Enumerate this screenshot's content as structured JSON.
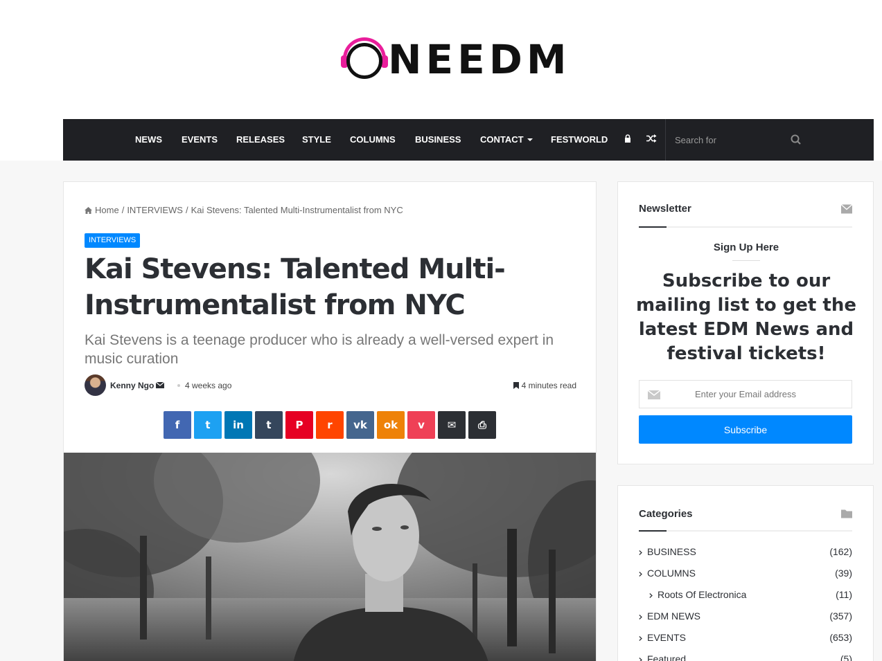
{
  "site": {
    "logo_text": "ONEEDM",
    "logo_rest": "NEEDM"
  },
  "nav": {
    "items": [
      "NEWS",
      "EVENTS",
      "RELEASES",
      "STYLE",
      "COLUMNS",
      "BUSINESS",
      "CONTACT",
      "FESTWORLD"
    ],
    "search_placeholder": "Search for",
    "icons": [
      "lock-icon",
      "random-icon",
      "search-icon"
    ]
  },
  "breadcrumb": {
    "home": "Home",
    "section": "INTERVIEWS",
    "current": "Kai Stevens: Talented Multi-Instrumentalist from NYC",
    "separator": "/"
  },
  "article": {
    "category": "INTERVIEWS",
    "title": "Kai Stevens: Talented Multi-Instrumentalist from NYC",
    "subtitle": "Kai Stevens is a teenage producer who is already a well-versed expert in music curation",
    "author": "Kenny Ngo",
    "date": "4 weeks ago",
    "read_time": "4 minutes read"
  },
  "share": [
    {
      "name": "facebook",
      "glyph": "f",
      "color": "#4267b2"
    },
    {
      "name": "twitter",
      "glyph": "t",
      "color": "#1da1f2"
    },
    {
      "name": "linkedin",
      "glyph": "in",
      "color": "#0077b5"
    },
    {
      "name": "tumblr",
      "glyph": "t",
      "color": "#35465c"
    },
    {
      "name": "pinterest",
      "glyph": "P",
      "color": "#e60023"
    },
    {
      "name": "reddit",
      "glyph": "r",
      "color": "#ff4500"
    },
    {
      "name": "vk",
      "glyph": "vk",
      "color": "#45668e"
    },
    {
      "name": "odnoklassniki",
      "glyph": "ok",
      "color": "#ee8208"
    },
    {
      "name": "pocket",
      "glyph": "v",
      "color": "#ef4056"
    },
    {
      "name": "email",
      "glyph": "✉",
      "color": "#2c2f34"
    },
    {
      "name": "print",
      "glyph": "⎙",
      "color": "#2c2f34"
    }
  ],
  "newsletter": {
    "title": "Newsletter",
    "signup": "Sign Up Here",
    "promo": "Subscribe to our mailing list to get the latest EDM News and festival tickets!",
    "email_placeholder": "Enter your Email address",
    "button": "Subscribe"
  },
  "categories": {
    "title": "Categories",
    "items": [
      {
        "label": "BUSINESS",
        "count": "(162)",
        "child": false
      },
      {
        "label": "COLUMNS",
        "count": "(39)",
        "child": false
      },
      {
        "label": "Roots Of Electronica",
        "count": "(11)",
        "child": true
      },
      {
        "label": "EDM NEWS",
        "count": "(357)",
        "child": false
      },
      {
        "label": "EVENTS",
        "count": "(653)",
        "child": false
      },
      {
        "label": "Featured",
        "count": "(5)",
        "child": false
      }
    ]
  }
}
